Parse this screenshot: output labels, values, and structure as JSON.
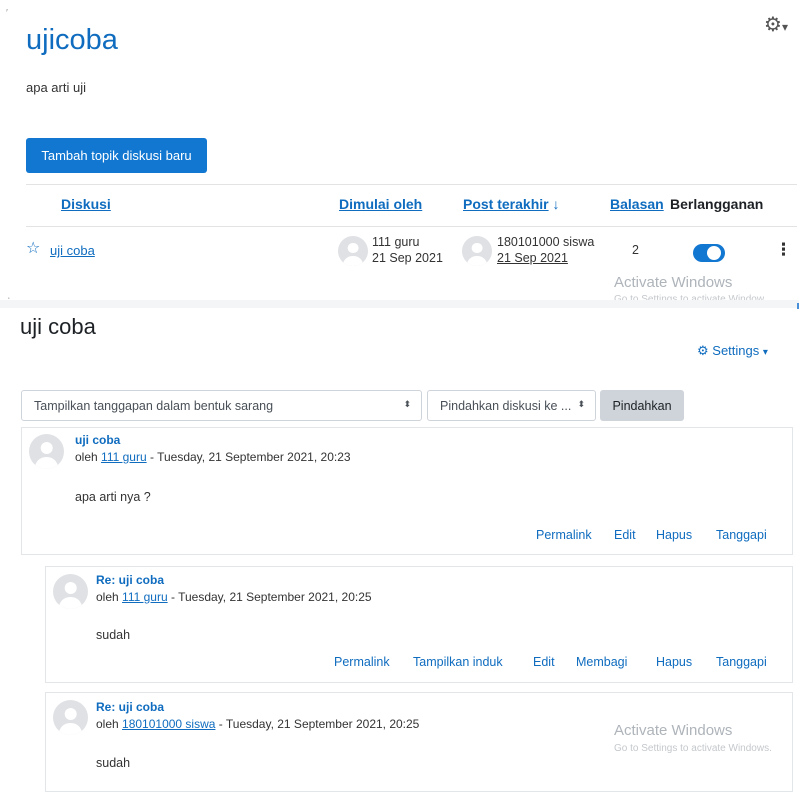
{
  "forum": {
    "title": "ujicoba",
    "intro": "apa arti uji",
    "add_topic_label": "Tambah topik diskusi baru",
    "columns": {
      "discussion": "Diskusi",
      "started_by": "Dimulai oleh",
      "last_post": "Post terakhir",
      "last_post_sort_icon": "↓",
      "replies": "Balasan",
      "subscription": "Berlangganan"
    },
    "rows": [
      {
        "title": "uji coba",
        "star_icon": "☆",
        "starter_name": "111 guru",
        "starter_date": "21 Sep 2021",
        "last_name": "180101000 siswa",
        "last_date": "21 Sep 2021",
        "replies": "2",
        "subscribed": true,
        "menu_icon": "⋮"
      }
    ],
    "gear_icon": "⚙",
    "gear_caret": "▾"
  },
  "watermark": {
    "line1": "Activate Windows",
    "line2": "Go to Settings to activate Windows.",
    "line2_top_cut": "Go to Settings to activate Window"
  },
  "discussion": {
    "title": "uji coba",
    "settings_label": "Settings",
    "settings_icon": "⚙",
    "settings_caret": "▾",
    "display_mode": "Tampilkan tanggapan dalam bentuk sarang",
    "move_placeholder": "Pindahkan diskusi ke ...",
    "select_arrow": "⬍",
    "move_button": "Pindahkan",
    "posts": [
      {
        "subject": "uji coba",
        "by_prefix": "oleh",
        "author": "111 guru",
        "date": "- Tuesday, 21 September 2021, 20:23",
        "body": "apa arti nya ?",
        "actions": [
          "Permalink",
          "Edit",
          "Hapus",
          "Tanggapi"
        ]
      },
      {
        "subject": "Re: uji coba",
        "by_prefix": "oleh",
        "author": "111 guru",
        "date": "- Tuesday, 21 September 2021, 20:25",
        "body": "sudah",
        "actions": [
          "Permalink",
          "Tampilkan induk",
          "Edit",
          "Membagi",
          "Hapus",
          "Tanggapi"
        ]
      },
      {
        "subject": "Re: uji coba",
        "by_prefix": "oleh",
        "author": "180101000 siswa",
        "date": "- Tuesday, 21 September 2021, 20:25",
        "body": "sudah",
        "actions": []
      }
    ]
  },
  "colors": {
    "link": "#0f6cbf",
    "primary_button": "#1177d1",
    "secondary_button": "#ced4da"
  }
}
